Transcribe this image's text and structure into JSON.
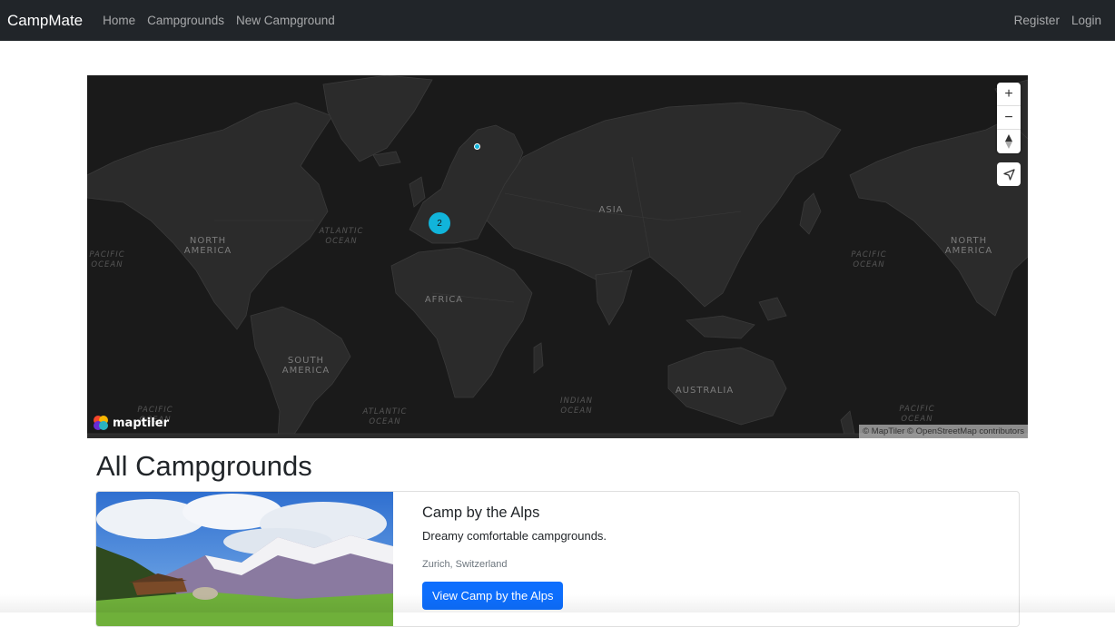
{
  "navbar": {
    "brand": "CampMate",
    "links": [
      "Home",
      "Campgrounds",
      "New Campground"
    ],
    "right_links": [
      "Register",
      "Login"
    ]
  },
  "map": {
    "labels": {
      "pacific_ocean_w": "PACIFIC\nOCEAN",
      "north_america_w": "NORTH\nAMERICA",
      "atlantic_ocean_n": "ATLANTIC\nOCEAN",
      "asia": "ASIA",
      "north_america_e": "NORTH\nAMERICA",
      "pacific_ocean_e": "PACIFIC\nOCEAN",
      "africa": "AFRICA",
      "south_america": "SOUTH\nAMERICA",
      "pacific_ocean_sw": "PACIFIC\nOCEAN",
      "atlantic_ocean_s": "ATLANTIC\nOCEAN",
      "indian_ocean": "INDIAN\nOCEAN",
      "australia": "AUSTRALIA",
      "pacific_ocean_se": "PACIFIC\nOCEAN"
    },
    "cluster_count": "2",
    "controls": {
      "zoom_in": "+",
      "zoom_out": "−"
    },
    "logo_text": "maptiler",
    "attribution": "© MapTiler © OpenStreetMap contributors",
    "colors": {
      "background": "#1a1a1a",
      "land": "#2b2b2b",
      "marker": "#11b4da"
    }
  },
  "page": {
    "title": "All Campgrounds"
  },
  "campgrounds": [
    {
      "title": "Camp by the Alps",
      "description": "Dreamy comfortable campgrounds.",
      "location": "Zurich, Switzerland",
      "button_label": "View Camp by the Alps"
    }
  ],
  "colors": {
    "navbar": "#212529",
    "primary": "#0d6efd"
  }
}
